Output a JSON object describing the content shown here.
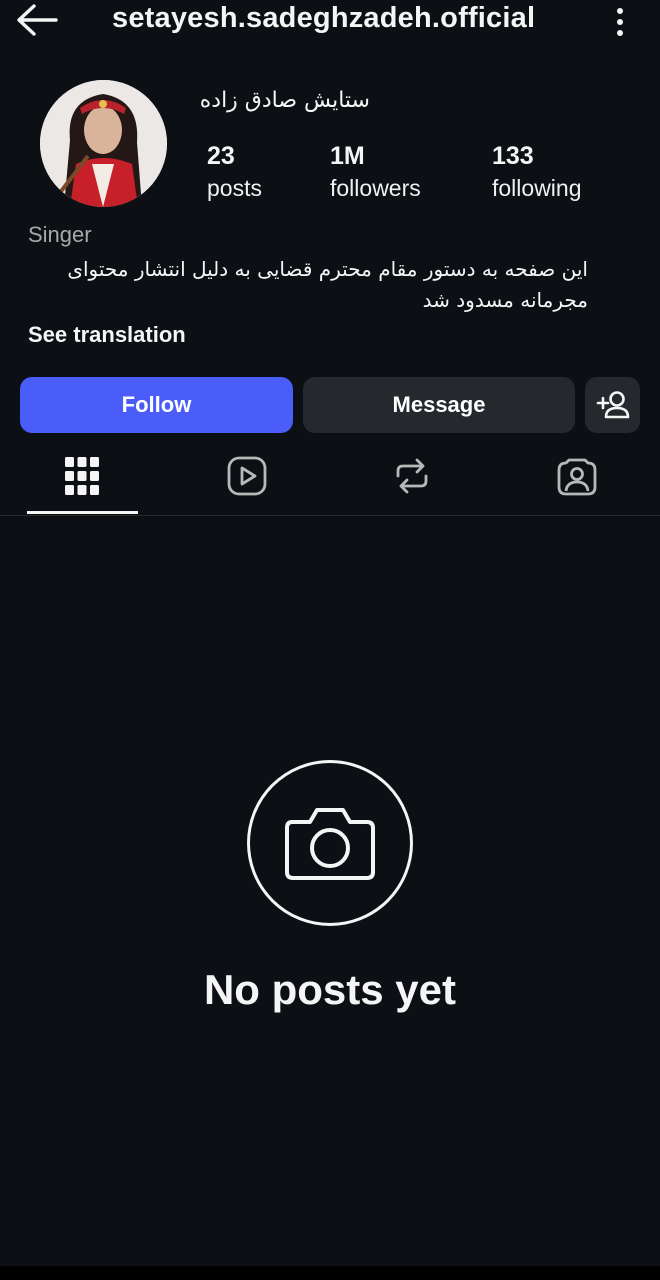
{
  "header": {
    "username": "setayesh.sadeghzadeh.official",
    "back_icon": "arrow-left-icon",
    "more_icon": "more-vertical-icon"
  },
  "profile": {
    "display_name": "ستایش صادق زاده",
    "stats": [
      {
        "value": "23",
        "label": "posts"
      },
      {
        "value": "1M",
        "label": "followers"
      },
      {
        "value": "133",
        "label": "following"
      }
    ],
    "category": "Singer",
    "bio_line1": "این صفحه به دستور مقام محترم قضایی به دلیل انتشار محتوای",
    "bio_line2": "مجرمانه مسدود شد",
    "see_translation": "See translation"
  },
  "actions": {
    "follow_label": "Follow",
    "message_label": "Message",
    "add_user_icon": "person-add-icon"
  },
  "tabs": [
    {
      "icon": "grid-icon",
      "active": true
    },
    {
      "icon": "reels-icon",
      "active": false
    },
    {
      "icon": "reposts-icon",
      "active": false
    },
    {
      "icon": "tagged-icon",
      "active": false
    }
  ],
  "empty_state": {
    "icon": "camera-icon",
    "text": "No posts yet"
  },
  "colors": {
    "background": "#0c1014",
    "follow_button": "#4a5df9",
    "secondary_button": "#25292e",
    "muted_text": "#a8a8a8"
  }
}
